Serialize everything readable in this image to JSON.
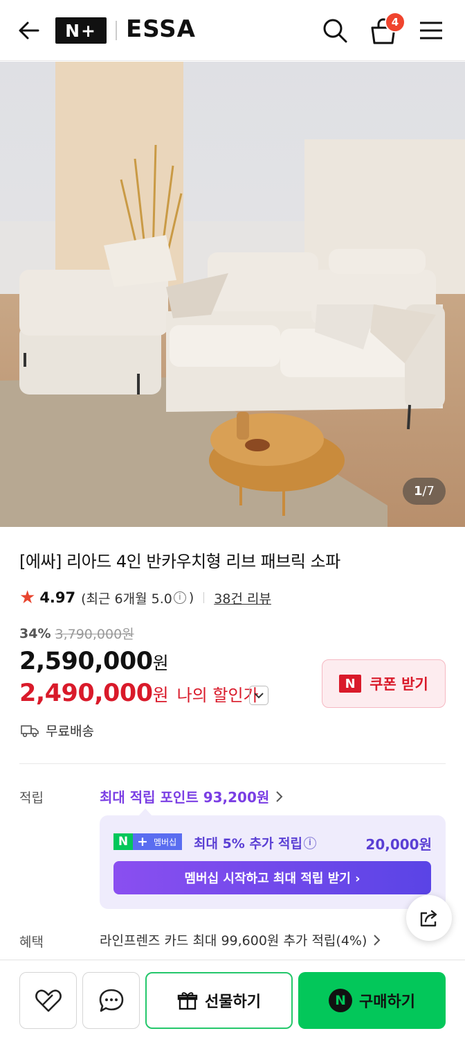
{
  "header": {
    "logo_badge": "N+",
    "brand": "ESSA",
    "cart_count": "4",
    "icons": [
      "back-arrow-icon",
      "search-icon",
      "shopping-bag-icon",
      "menu-icon"
    ]
  },
  "hero": {
    "image_counter_current": "1",
    "image_counter_total": "/7"
  },
  "product": {
    "title": "[에싸] 리아드 4인 반카우치형 리브 패브릭 소파",
    "rating": "4.97",
    "recent_rating": "(최근 6개월 5.0",
    "recent_rating_close": ")",
    "review_link": "38건 리뷰",
    "discount_pct": "34%",
    "original_price": "3,790,000원",
    "price": "2,590,000",
    "price_unit": "원",
    "my_price": "2,490,000",
    "my_price_unit": "원",
    "my_price_label": "나의 할인가",
    "coupon_logo": "N",
    "coupon_button": "쿠폰 받기",
    "shipping": "무료배송"
  },
  "points": {
    "label": "적립",
    "max_points": "최대 적립 포인트 93,200원",
    "membership_badge_n": "N",
    "membership_badge_plus": "+",
    "membership_badge_text": "멤버십",
    "membership_extra": "최대 5% 추가 적립",
    "membership_amount": "20,000원",
    "membership_button": "멤버십 시작하고 최대 적립 받기 ›"
  },
  "benefit": {
    "label": "혜택",
    "text": "라인프렌즈 카드 최대 99,600원 추가 적립(4%)"
  },
  "bottom_bar": {
    "gift_label": "선물하기",
    "buy_logo": "N",
    "buy_label": "구매하기"
  },
  "colors": {
    "naver_green": "#03c75a",
    "discount_red": "#d91a2a",
    "membership_purple": "#7b3fe4",
    "badge_orange": "#f0442e"
  }
}
